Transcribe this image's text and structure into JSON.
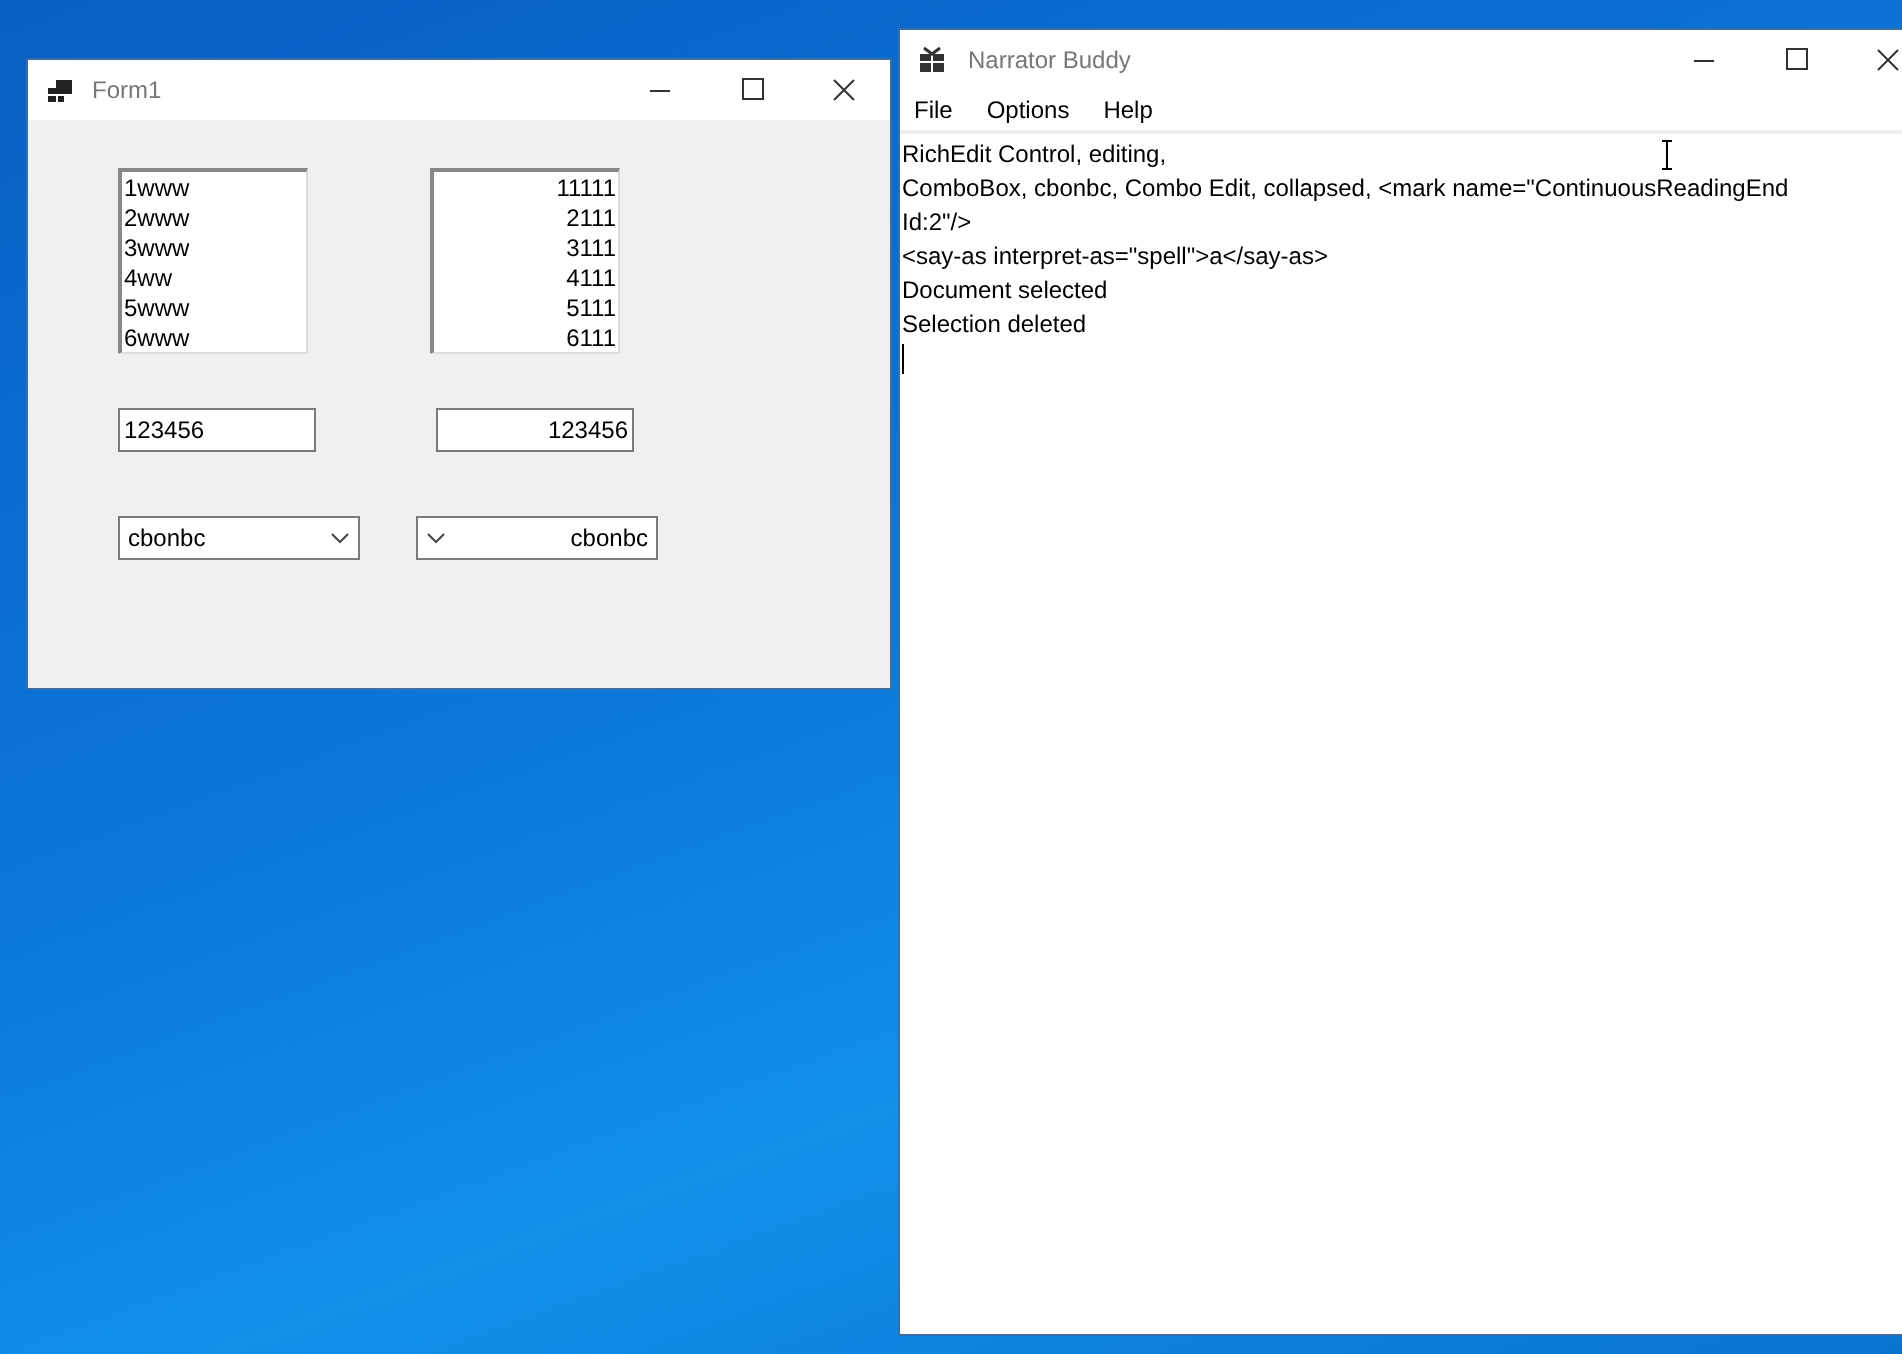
{
  "form1": {
    "title": "Form1",
    "listboxes": [
      {
        "rtl": false,
        "items": [
          "1www",
          "2www",
          "3www",
          "4ww",
          "5www",
          "6www"
        ]
      },
      {
        "rtl": true,
        "items": [
          "11111",
          "2111",
          "3111",
          "4111",
          "5111",
          "6111"
        ]
      }
    ],
    "textboxes": [
      {
        "rtl": false,
        "value": "123456"
      },
      {
        "rtl": true,
        "value": "123456"
      }
    ],
    "comboboxes": [
      {
        "rtl": false,
        "value": "cbonbc"
      },
      {
        "rtl": true,
        "value": "cbonbc"
      }
    ]
  },
  "narrator": {
    "title": "Narrator Buddy",
    "menu": [
      "File",
      "Options",
      "Help"
    ],
    "lines": [
      "RichEdit Control, editing,",
      "ComboBox, cbonbc, Combo Edit, collapsed, <mark name=\"ContinuousReadingEnd",
      "Id:2\"/>",
      "<say-as interpret-as=\"spell\">a</say-as>",
      "Document selected",
      "Selection deleted"
    ]
  }
}
